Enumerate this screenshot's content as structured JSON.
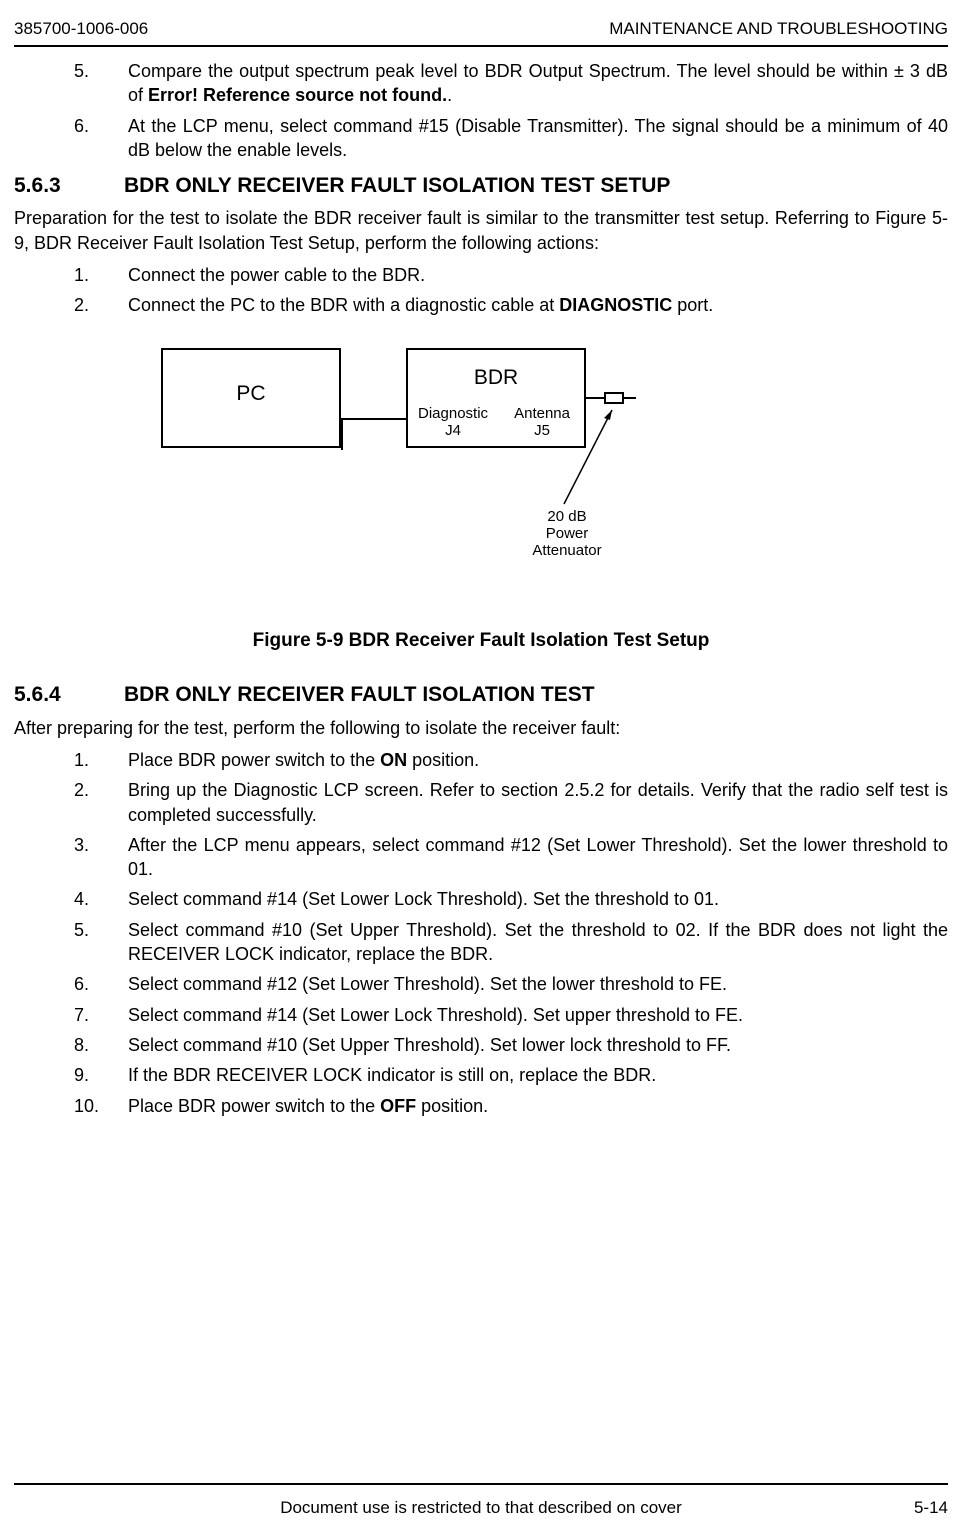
{
  "header": {
    "doc_num": "385700-1006-006",
    "title": "MAINTENANCE AND TROUBLESHOOTING"
  },
  "pre_list": {
    "items": [
      {
        "num": "5.",
        "parts": [
          {
            "text": "Compare the output spectrum peak level to   BDR Output Spectrum.  The level should be within ± 3 dB of ",
            "bold": false
          },
          {
            "text": "Error! Reference source not found.",
            "bold": true
          },
          {
            "text": ".",
            "bold": false
          }
        ]
      },
      {
        "num": "6.",
        "parts": [
          {
            "text": "At the LCP menu, select command #15 (Disable Transmitter).  The signal should be a minimum of 40 dB below the enable levels.",
            "bold": false
          }
        ]
      }
    ]
  },
  "section_5_6_3": {
    "secnum": "5.6.3",
    "title": "BDR ONLY RECEIVER FAULT ISOLATION TEST SETUP",
    "intro": "Preparation for the test to isolate the BDR receiver fault is similar to the transmitter test setup. Referring to Figure 5-9, BDR Receiver Fault Isolation Test Setup, perform the following actions:",
    "items": [
      {
        "num": "1.",
        "parts": [
          {
            "text": "Connect the power cable to the BDR.",
            "bold": false
          }
        ]
      },
      {
        "num": "2.",
        "parts": [
          {
            "text": "Connect the PC to the BDR with a diagnostic cable at ",
            "bold": false
          },
          {
            "text": "DIAGNOSTIC",
            "bold": true
          },
          {
            "text": " port.",
            "bold": false
          }
        ]
      }
    ]
  },
  "diagram": {
    "pc_label": "PC",
    "bdr_label": "BDR",
    "diag_label_l1": "Diagnostic",
    "diag_label_l2": "J4",
    "ant_label_l1": "Antenna",
    "ant_label_l2": "J5",
    "attn_l1": "20 dB",
    "attn_l2": "Power",
    "attn_l3": "Attenuator"
  },
  "figure_caption": "Figure 5-9  BDR Receiver Fault Isolation Test Setup",
  "section_5_6_4": {
    "secnum": "5.6.4",
    "title": "BDR ONLY RECEIVER FAULT ISOLATION TEST",
    "intro": "After preparing for the test, perform the following to isolate the receiver fault:",
    "items": [
      {
        "num": "1.",
        "parts": [
          {
            "text": "Place BDR power switch to the ",
            "bold": false
          },
          {
            "text": "ON",
            "bold": true
          },
          {
            "text": " position.",
            "bold": false
          }
        ]
      },
      {
        "num": "2.",
        "parts": [
          {
            "text": "Bring up the Diagnostic LCP screen.  Refer to section 2.5.2 for details. Verify that the radio self test is completed successfully.",
            "bold": false
          }
        ]
      },
      {
        "num": "3.",
        "parts": [
          {
            "text": "After the LCP menu appears, select command #12 (Set Lower Threshold).  Set the lower threshold to 01.",
            "bold": false
          }
        ]
      },
      {
        "num": "4.",
        "parts": [
          {
            "text": "Select command #14 (Set Lower Lock Threshold).  Set the threshold to 01.",
            "bold": false
          }
        ]
      },
      {
        "num": "5.",
        "parts": [
          {
            "text": "Select command #10 (Set Upper Threshold).  Set the threshold to 02.  If the BDR does not light the RECEIVER LOCK indicator, replace the BDR.",
            "bold": false
          }
        ]
      },
      {
        "num": "6.",
        "parts": [
          {
            "text": "Select command #12 (Set Lower Threshold).  Set the lower threshold to FE.",
            "bold": false
          }
        ]
      },
      {
        "num": "7.",
        "parts": [
          {
            "text": "Select command #14 (Set Lower Lock Threshold).  Set upper threshold to FE.",
            "bold": false
          }
        ]
      },
      {
        "num": "8.",
        "parts": [
          {
            "text": "Select command #10 (Set Upper Threshold).  Set lower lock threshold to FF.",
            "bold": false
          }
        ]
      },
      {
        "num": "9.",
        "parts": [
          {
            "text": "If the  BDR RECEIVER LOCK indicator is still on, replace the BDR.",
            "bold": false
          }
        ]
      },
      {
        "num": "10.",
        "parts": [
          {
            "text": "Place BDR power switch to the ",
            "bold": false
          },
          {
            "text": "OFF",
            "bold": true
          },
          {
            "text": " position.",
            "bold": false
          }
        ]
      }
    ]
  },
  "footer": {
    "center": "Document use is restricted to that described on cover",
    "page_num": "5-14"
  }
}
